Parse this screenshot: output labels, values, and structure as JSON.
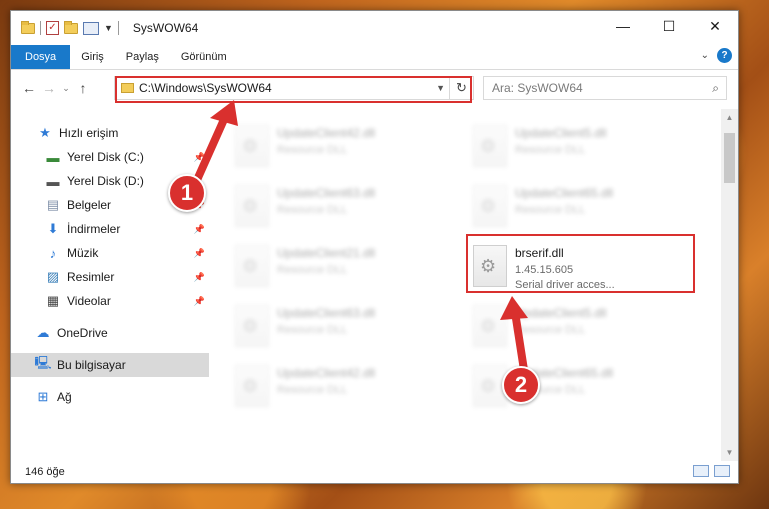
{
  "window": {
    "title": "SysWOW64",
    "controls": {
      "minimize": "—",
      "maximize": "☐",
      "close": "✕"
    }
  },
  "ribbon": {
    "tabs": [
      {
        "label": "Dosya",
        "active": true
      },
      {
        "label": "Giriş",
        "active": false
      },
      {
        "label": "Paylaş",
        "active": false
      },
      {
        "label": "Görünüm",
        "active": false
      }
    ],
    "help": "?"
  },
  "address": {
    "path": "C:\\Windows\\SysWOW64"
  },
  "search": {
    "placeholder": "Ara: SysWOW64"
  },
  "sidebar": {
    "items": [
      {
        "label": "Hızlı erişim",
        "icon": "star-icon"
      },
      {
        "label": "Yerel Disk (C:)",
        "icon": "drive-icon",
        "pinned": true
      },
      {
        "label": "Yerel Disk (D:)",
        "icon": "drive-icon"
      },
      {
        "label": "Belgeler",
        "icon": "documents-icon",
        "pinned": true
      },
      {
        "label": "İndirmeler",
        "icon": "downloads-icon",
        "pinned": true
      },
      {
        "label": "Müzik",
        "icon": "music-icon",
        "pinned": true
      },
      {
        "label": "Resimler",
        "icon": "pictures-icon",
        "pinned": true
      },
      {
        "label": "Videolar",
        "icon": "videos-icon",
        "pinned": true
      },
      {
        "label": "OneDrive",
        "icon": "cloud-icon"
      },
      {
        "label": "Bu bilgisayar",
        "icon": "computer-icon",
        "selected": true
      },
      {
        "label": "Ağ",
        "icon": "network-icon"
      }
    ]
  },
  "files": [
    {
      "name": "UpdateClient42.dll",
      "type": "Resource DLL"
    },
    {
      "name": "UpdateClient5.dll",
      "type": "Resource DLL"
    },
    {
      "name": "UpdateClient63.dll",
      "type": "Resource DLL"
    },
    {
      "name": "UpdateClient65.dll",
      "type": "Resource DLL"
    },
    {
      "name": "UpdateClient21.dll",
      "type": "Resource DLL"
    },
    {
      "name": "brserif.dll",
      "version": "1.45.15.605",
      "description": "Serial driver acces..."
    },
    {
      "name": "UpdateClient63.dll",
      "type": "Resource DLL"
    },
    {
      "name": "UpdateClient5.dll",
      "type": "Resource DLL"
    },
    {
      "name": "UpdateClient42.dll",
      "type": "Resource DLL"
    },
    {
      "name": "UpdateClient65.dll",
      "type": "Resource DLL"
    }
  ],
  "status": {
    "item_count": "146 öğe"
  },
  "annotations": {
    "badge1": "1",
    "badge2": "2",
    "color": "#d9302e"
  }
}
